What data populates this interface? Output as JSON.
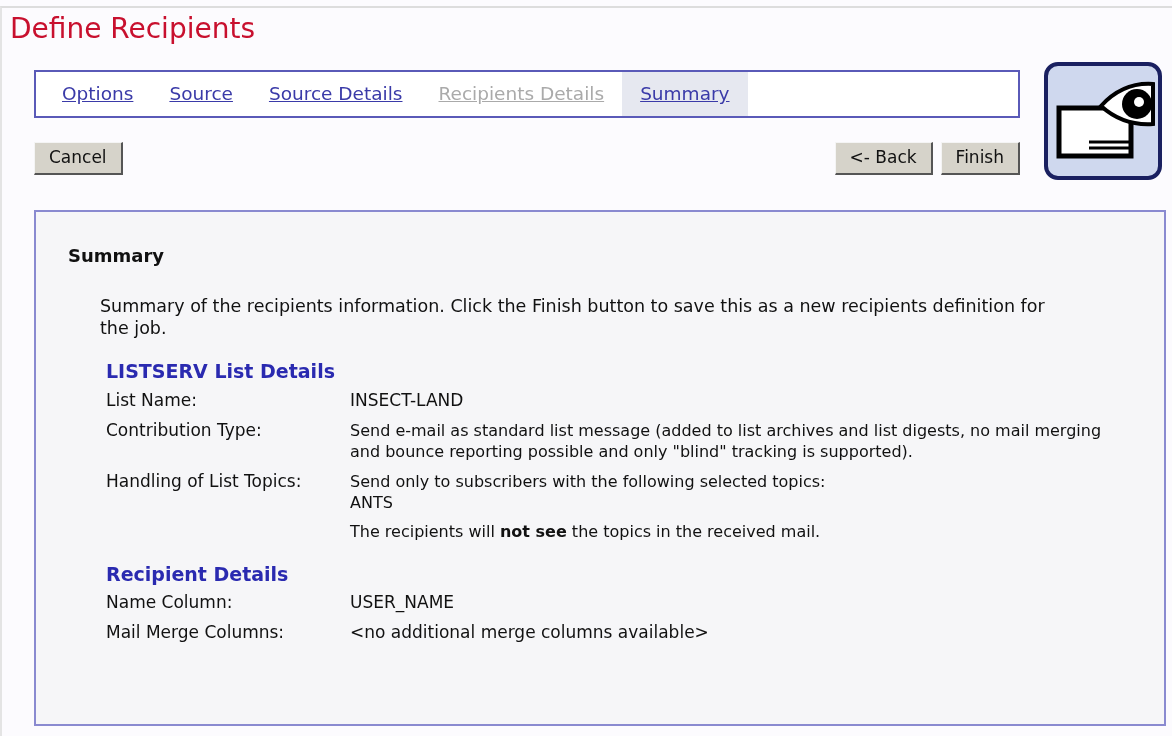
{
  "title": "Define Recipients",
  "tabs": [
    {
      "label": "Options",
      "selected": false,
      "disabled": false
    },
    {
      "label": "Source",
      "selected": false,
      "disabled": false
    },
    {
      "label": "Source Details",
      "selected": false,
      "disabled": false
    },
    {
      "label": "Recipients Details",
      "selected": false,
      "disabled": true
    },
    {
      "label": "Summary",
      "selected": true,
      "disabled": false
    }
  ],
  "buttons_left": [
    "Cancel"
  ],
  "buttons_right": [
    "<- Back",
    "Finish"
  ],
  "panel": {
    "heading": "Summary",
    "intro": "Summary of the recipients information. Click the Finish button to save this as a new recipients definition for the job.",
    "sections": [
      {
        "title": "LISTSERV List Details",
        "rows": [
          {
            "label": "List Name:",
            "lines": [
              "INSECT-LAND"
            ]
          },
          {
            "label": "Contribution Type:",
            "lines": [
              "Send e-mail as standard list message (added to list archives and list digests, no mail merging and bounce reporting possible and only \"blind\" tracking is supported)."
            ]
          },
          {
            "label": "Handling of List Topics:",
            "lines": [
              "Send only to subscribers with the following selected topics:",
              "ANTS"
            ],
            "note": "The recipients will **not see** the topics in the received mail."
          }
        ]
      },
      {
        "title": "Recipient Details",
        "rows": [
          {
            "label": "Name Column:",
            "lines": [
              "USER_NAME"
            ]
          },
          {
            "label": "Mail Merge Columns:",
            "lines": [
              "<no additional merge columns available>"
            ]
          }
        ]
      }
    ]
  }
}
